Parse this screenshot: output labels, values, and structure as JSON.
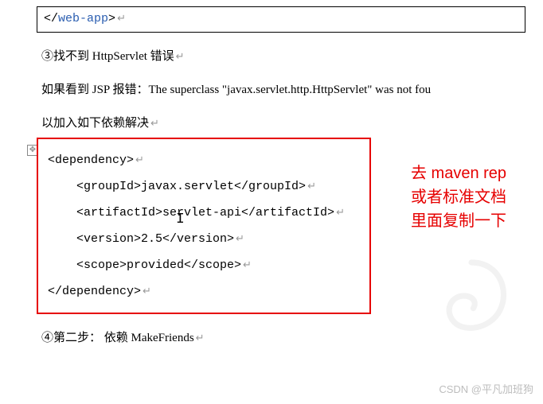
{
  "top_code": {
    "open": "<",
    "slash": "/",
    "tag": "web-app",
    "close": ">"
  },
  "paragraphs": {
    "p1": "③找不到 HttpServlet 错误",
    "p2": "如果看到 JSP 报错：The superclass \"javax.servlet.http.HttpServlet\" was not fou",
    "p3": "以加入如下依赖解决",
    "p4": "④第二步： 依赖 MakeFriends"
  },
  "enter_mark": "↵",
  "xml": {
    "l1": "<dependency>",
    "l2": "    <groupId>javax.servlet</groupId>",
    "l3_a": "    <artifactId>se",
    "l3_b": "rvlet-api</artifactId>",
    "l4": "    <version>2.5</version>",
    "l5": "    <scope>provided</scope>",
    "l6": "</dependency>"
  },
  "annotation": {
    "line1": "去 maven rep",
    "line2": "或者标准文档",
    "line3": "里面复制一下"
  },
  "watermark": "CSDN @平凡加班狗",
  "colors": {
    "red": "#e60000",
    "tag_blue": "#2a5db0"
  }
}
